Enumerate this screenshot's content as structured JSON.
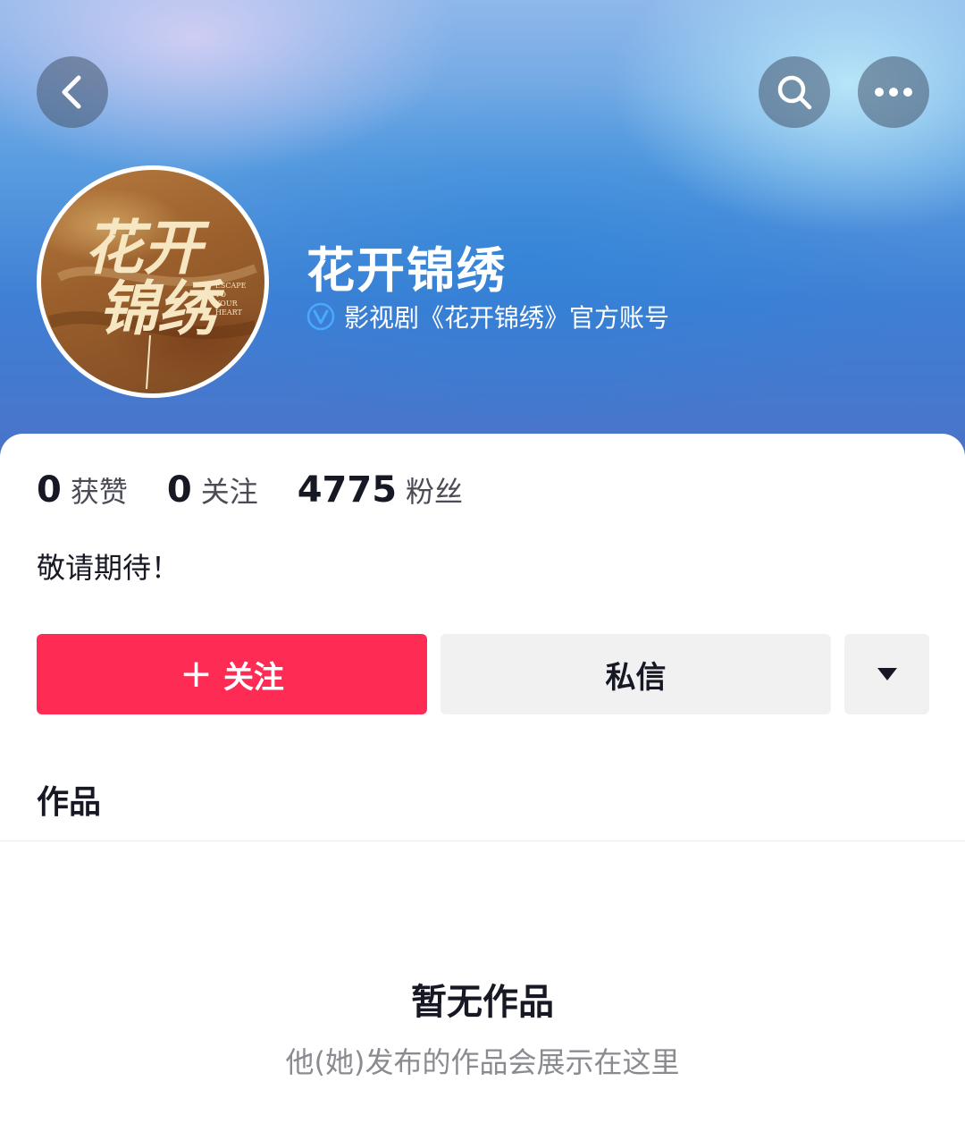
{
  "profile": {
    "name": "花开锦绣",
    "verification": "影视剧《花开锦绣》官方账号",
    "bio": "敬请期待！",
    "avatar_text": {
      "title": "花开锦绣",
      "subtitle": "ESCAPE TO YOUR HEART"
    }
  },
  "stats": [
    {
      "value": "0",
      "label": "获赞"
    },
    {
      "value": "0",
      "label": "关注"
    },
    {
      "value": "4775",
      "label": "粉丝"
    }
  ],
  "actions": {
    "follow_label": "关注",
    "message_label": "私信"
  },
  "tabs": {
    "works_label": "作品"
  },
  "empty_state": {
    "title": "暂无作品",
    "subtitle": "他(她)发布的作品会展示在这里"
  },
  "icons": {
    "back": "chevron-left-icon",
    "search": "search-icon",
    "more": "more-dots-icon",
    "verified": "verified-v-icon",
    "dropdown": "triangle-down-icon"
  },
  "colors": {
    "accent": "#fe2c55",
    "secondary_button": "#f1f1f2",
    "verified_badge": "#4aa8ff"
  }
}
